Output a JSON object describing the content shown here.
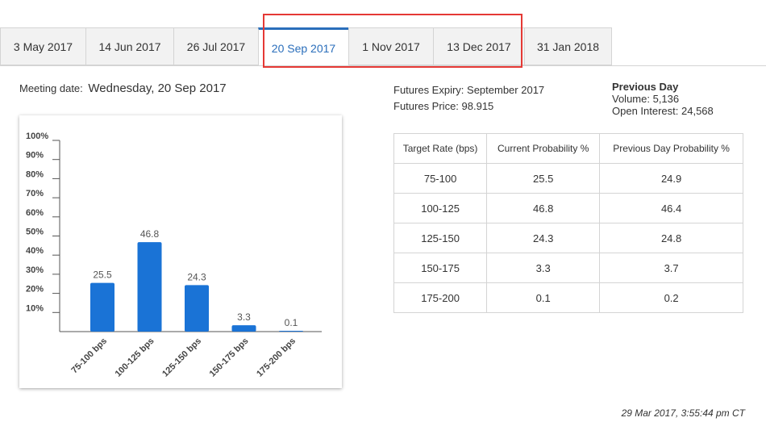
{
  "tabs": [
    {
      "label": "3 May 2017"
    },
    {
      "label": "14 Jun 2017"
    },
    {
      "label": "26 Jul 2017"
    },
    {
      "label": "20 Sep 2017",
      "active": true
    },
    {
      "label": "1 Nov 2017"
    },
    {
      "label": "13 Dec 2017"
    },
    {
      "label": "31 Jan 2018"
    }
  ],
  "meeting": {
    "label": "Meeting date:",
    "value": "Wednesday, 20 Sep 2017"
  },
  "futures": {
    "expiry": "Futures Expiry: September 2017",
    "price": "Futures Price: 98.915"
  },
  "previous_day": {
    "title": "Previous Day",
    "volume": "Volume: 5,136",
    "open_interest": "Open Interest: 24,568"
  },
  "table": {
    "headers": [
      "Target Rate (bps)",
      "Current Probability %",
      "Previous Day Probability %"
    ],
    "rows": [
      [
        "75-100",
        "25.5",
        "24.9"
      ],
      [
        "100-125",
        "46.8",
        "46.4"
      ],
      [
        "125-150",
        "24.3",
        "24.8"
      ],
      [
        "150-175",
        "3.3",
        "3.7"
      ],
      [
        "175-200",
        "0.1",
        "0.2"
      ]
    ]
  },
  "chart_data": {
    "type": "bar",
    "categories": [
      "75-100 bps",
      "100-125 bps",
      "125-150 bps",
      "150-175 bps",
      "175-200 bps"
    ],
    "values": [
      25.5,
      46.8,
      24.3,
      3.3,
      0.1
    ],
    "yticks": [
      "10%",
      "20%",
      "30%",
      "40%",
      "50%",
      "60%",
      "70%",
      "80%",
      "90%",
      "100%"
    ],
    "ylim": [
      0,
      100
    ],
    "bar_color": "#1a73d6"
  },
  "timestamp": "29 Mar 2017, 3:55:44 pm CT",
  "colors": {
    "accent": "#2a6ebb",
    "highlight": "#e53935"
  }
}
